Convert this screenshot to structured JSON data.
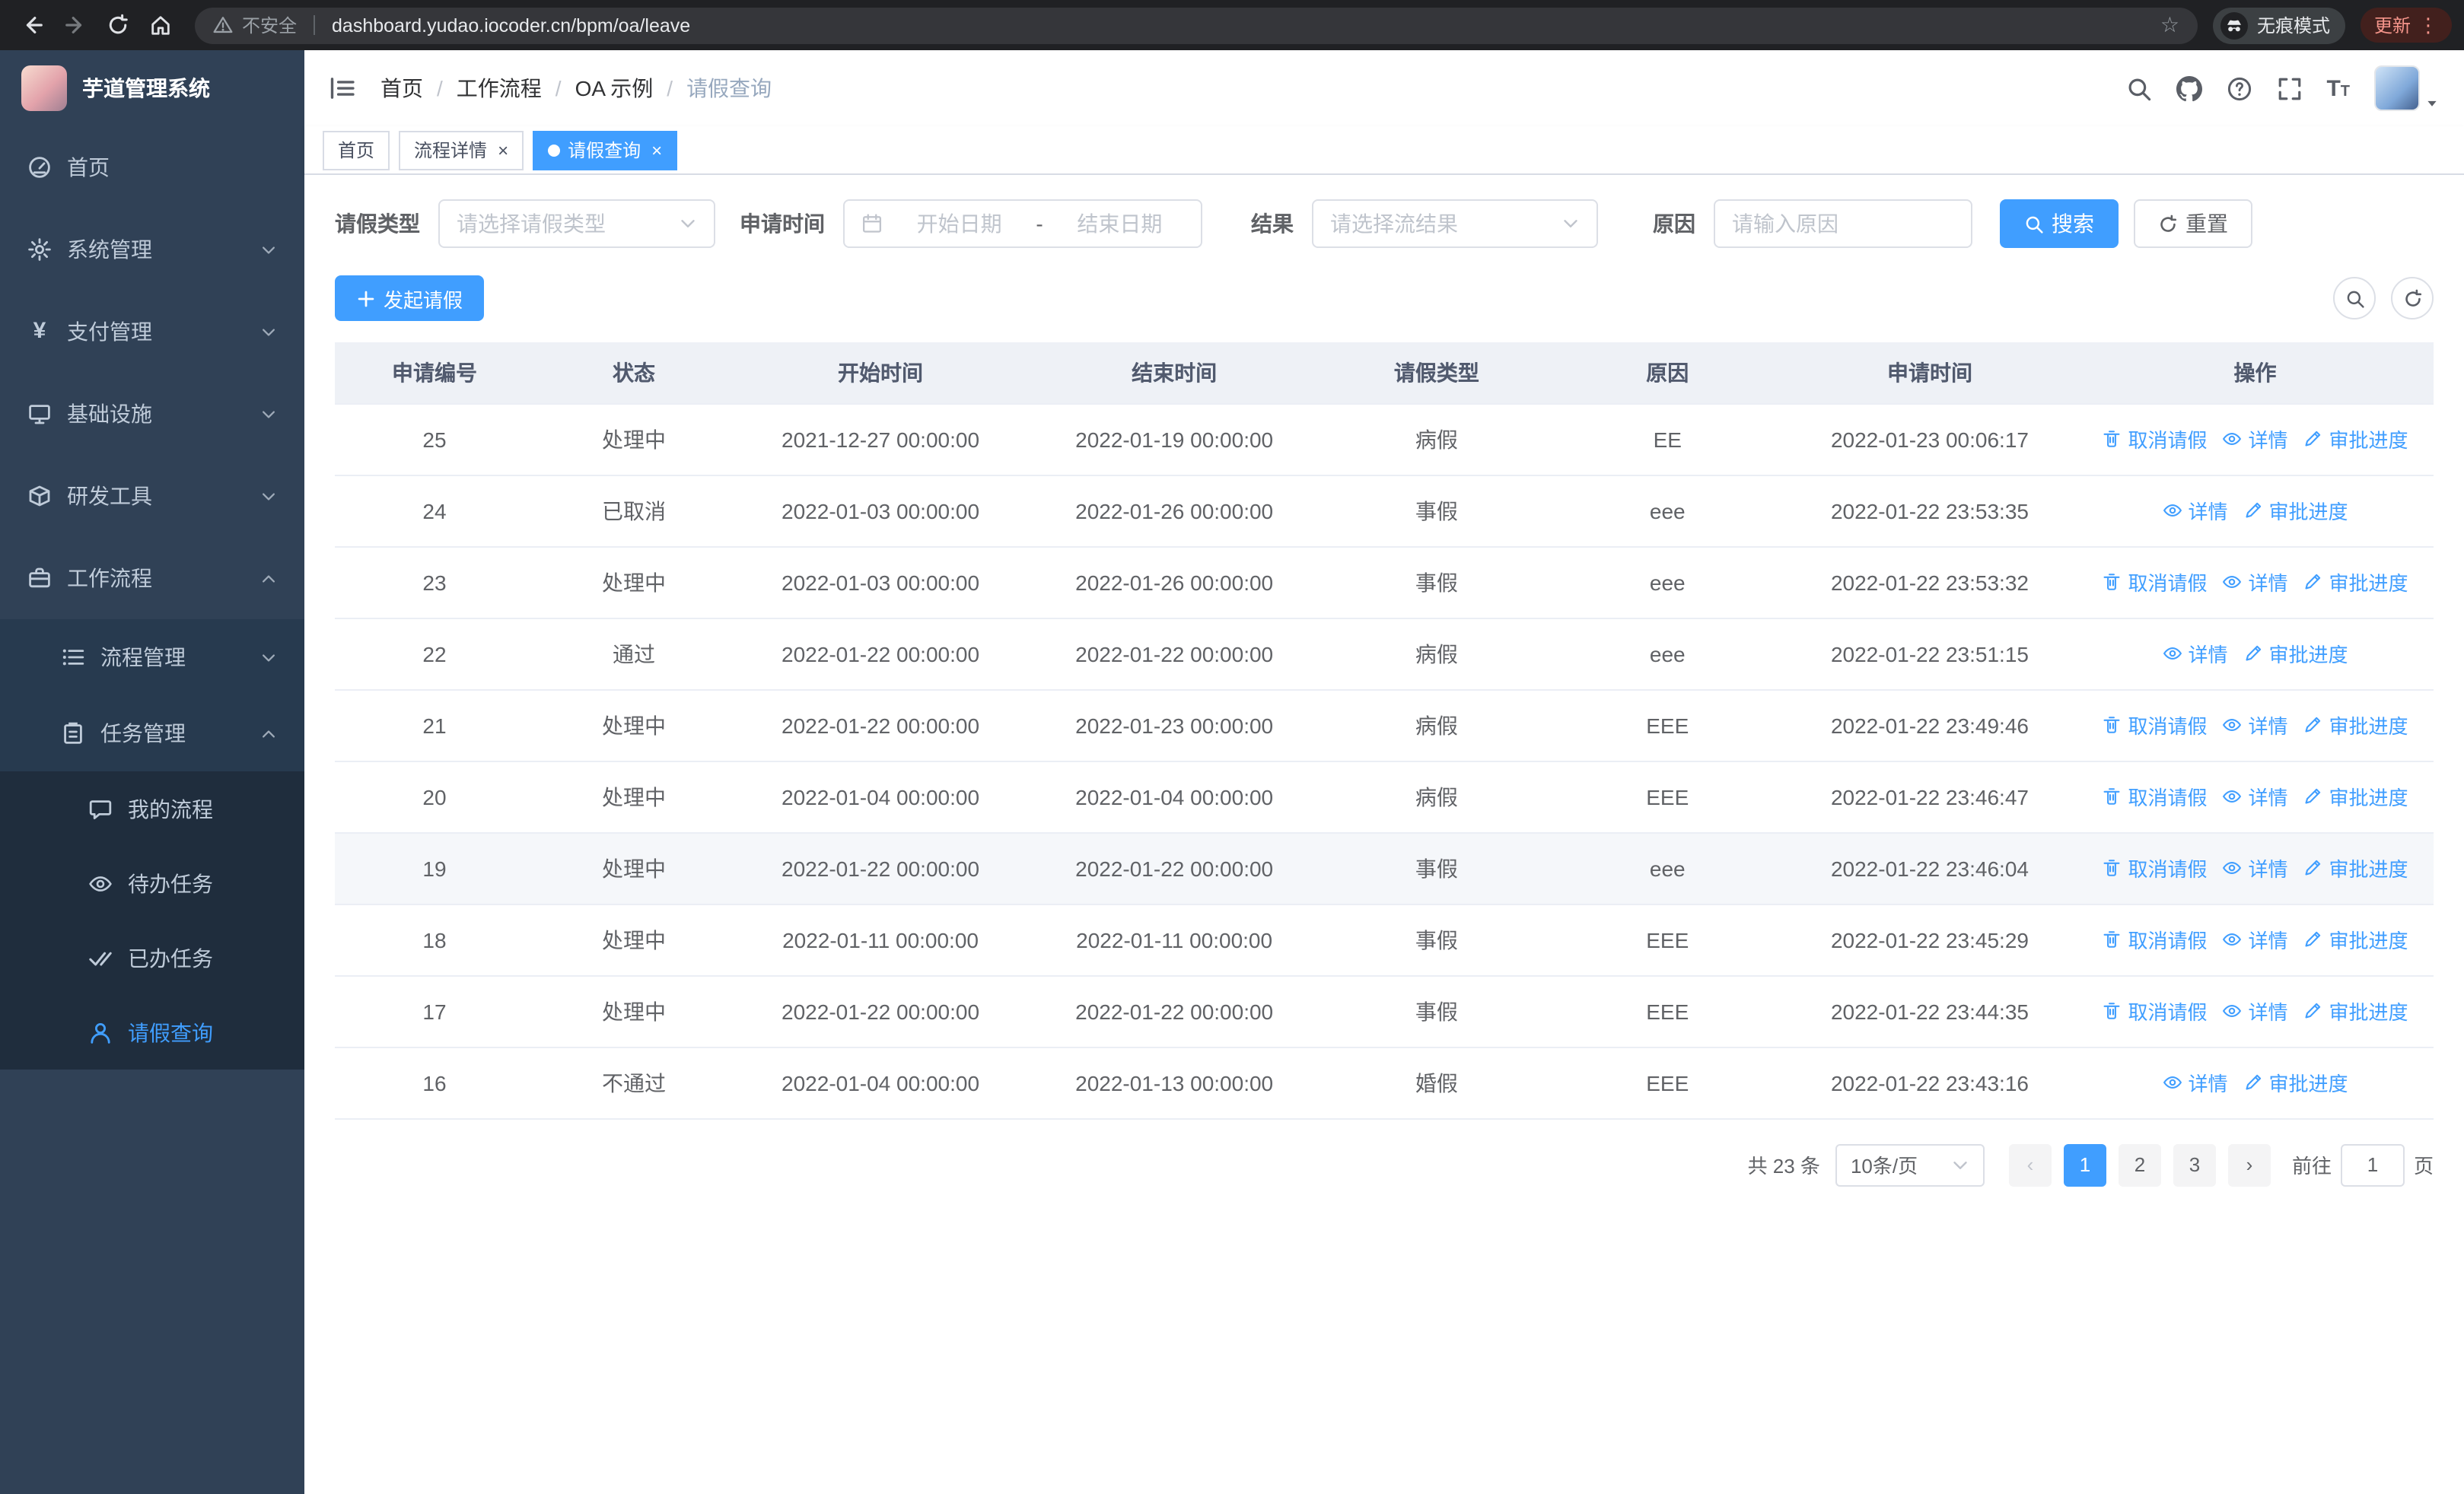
{
  "browser": {
    "security_label": "不安全",
    "url": "dashboard.yudao.iocoder.cn/bpm/oa/leave",
    "incognito_label": "无痕模式",
    "update_label": "更新"
  },
  "sidebar": {
    "app_title": "芋道管理系统",
    "menu": [
      {
        "label": "首页"
      },
      {
        "label": "系统管理"
      },
      {
        "label": "支付管理"
      },
      {
        "label": "基础设施"
      },
      {
        "label": "研发工具"
      },
      {
        "label": "工作流程"
      }
    ],
    "workflow_submenu": [
      {
        "label": "流程管理"
      },
      {
        "label": "任务管理"
      }
    ],
    "task_submenu": [
      {
        "label": "我的流程"
      },
      {
        "label": "待办任务"
      },
      {
        "label": "已办任务"
      },
      {
        "label": "请假查询"
      }
    ]
  },
  "header": {
    "breadcrumb": [
      "首页",
      "工作流程",
      "OA 示例",
      "请假查询"
    ]
  },
  "tabs": [
    {
      "label": "首页"
    },
    {
      "label": "流程详情"
    },
    {
      "label": "请假查询"
    }
  ],
  "filters": {
    "leave_type_label": "请假类型",
    "leave_type_placeholder": "请选择请假类型",
    "apply_time_label": "申请时间",
    "start_date_placeholder": "开始日期",
    "date_separator": "-",
    "end_date_placeholder": "结束日期",
    "result_label": "结果",
    "result_placeholder": "请选择流结果",
    "reason_label": "原因",
    "reason_placeholder": "请输入原因",
    "search_button": "搜索",
    "reset_button": "重置"
  },
  "toolbar": {
    "create_button": "发起请假"
  },
  "table": {
    "columns": [
      "申请编号",
      "状态",
      "开始时间",
      "结束时间",
      "请假类型",
      "原因",
      "申请时间",
      "操作"
    ],
    "action_labels": {
      "cancel": "取消请假",
      "detail": "详情",
      "progress": "审批进度"
    },
    "rows": [
      {
        "id": "25",
        "status": "处理中",
        "start": "2021-12-27 00:00:00",
        "end": "2022-01-19 00:00:00",
        "type": "病假",
        "reason": "EE",
        "applied": "2022-01-23 00:06:17",
        "actions": [
          "cancel",
          "detail",
          "progress"
        ]
      },
      {
        "id": "24",
        "status": "已取消",
        "start": "2022-01-03 00:00:00",
        "end": "2022-01-26 00:00:00",
        "type": "事假",
        "reason": "eee",
        "applied": "2022-01-22 23:53:35",
        "actions": [
          "detail",
          "progress"
        ]
      },
      {
        "id": "23",
        "status": "处理中",
        "start": "2022-01-03 00:00:00",
        "end": "2022-01-26 00:00:00",
        "type": "事假",
        "reason": "eee",
        "applied": "2022-01-22 23:53:32",
        "actions": [
          "cancel",
          "detail",
          "progress"
        ]
      },
      {
        "id": "22",
        "status": "通过",
        "start": "2022-01-22 00:00:00",
        "end": "2022-01-22 00:00:00",
        "type": "病假",
        "reason": "eee",
        "applied": "2022-01-22 23:51:15",
        "actions": [
          "detail",
          "progress"
        ]
      },
      {
        "id": "21",
        "status": "处理中",
        "start": "2022-01-22 00:00:00",
        "end": "2022-01-23 00:00:00",
        "type": "病假",
        "reason": "EEE",
        "applied": "2022-01-22 23:49:46",
        "actions": [
          "cancel",
          "detail",
          "progress"
        ]
      },
      {
        "id": "20",
        "status": "处理中",
        "start": "2022-01-04 00:00:00",
        "end": "2022-01-04 00:00:00",
        "type": "病假",
        "reason": "EEE",
        "applied": "2022-01-22 23:46:47",
        "actions": [
          "cancel",
          "detail",
          "progress"
        ]
      },
      {
        "id": "19",
        "status": "处理中",
        "start": "2022-01-22 00:00:00",
        "end": "2022-01-22 00:00:00",
        "type": "事假",
        "reason": "eee",
        "applied": "2022-01-22 23:46:04",
        "actions": [
          "cancel",
          "detail",
          "progress"
        ],
        "hover": true
      },
      {
        "id": "18",
        "status": "处理中",
        "start": "2022-01-11 00:00:00",
        "end": "2022-01-11 00:00:00",
        "type": "事假",
        "reason": "EEE",
        "applied": "2022-01-22 23:45:29",
        "actions": [
          "cancel",
          "detail",
          "progress"
        ]
      },
      {
        "id": "17",
        "status": "处理中",
        "start": "2022-01-22 00:00:00",
        "end": "2022-01-22 00:00:00",
        "type": "事假",
        "reason": "EEE",
        "applied": "2022-01-22 23:44:35",
        "actions": [
          "cancel",
          "detail",
          "progress"
        ]
      },
      {
        "id": "16",
        "status": "不通过",
        "start": "2022-01-04 00:00:00",
        "end": "2022-01-13 00:00:00",
        "type": "婚假",
        "reason": "EEE",
        "applied": "2022-01-22 23:43:16",
        "actions": [
          "detail",
          "progress"
        ]
      }
    ]
  },
  "pagination": {
    "total_label": "共 23 条",
    "page_size": "10条/页",
    "pages": [
      "1",
      "2",
      "3"
    ],
    "active_index": 0,
    "goto_label": "前往",
    "goto_value": "1",
    "goto_unit": "页"
  },
  "colors": {
    "accent": "#409eff",
    "sidebar_bg": "#304156",
    "chrome_bg": "#202124"
  }
}
